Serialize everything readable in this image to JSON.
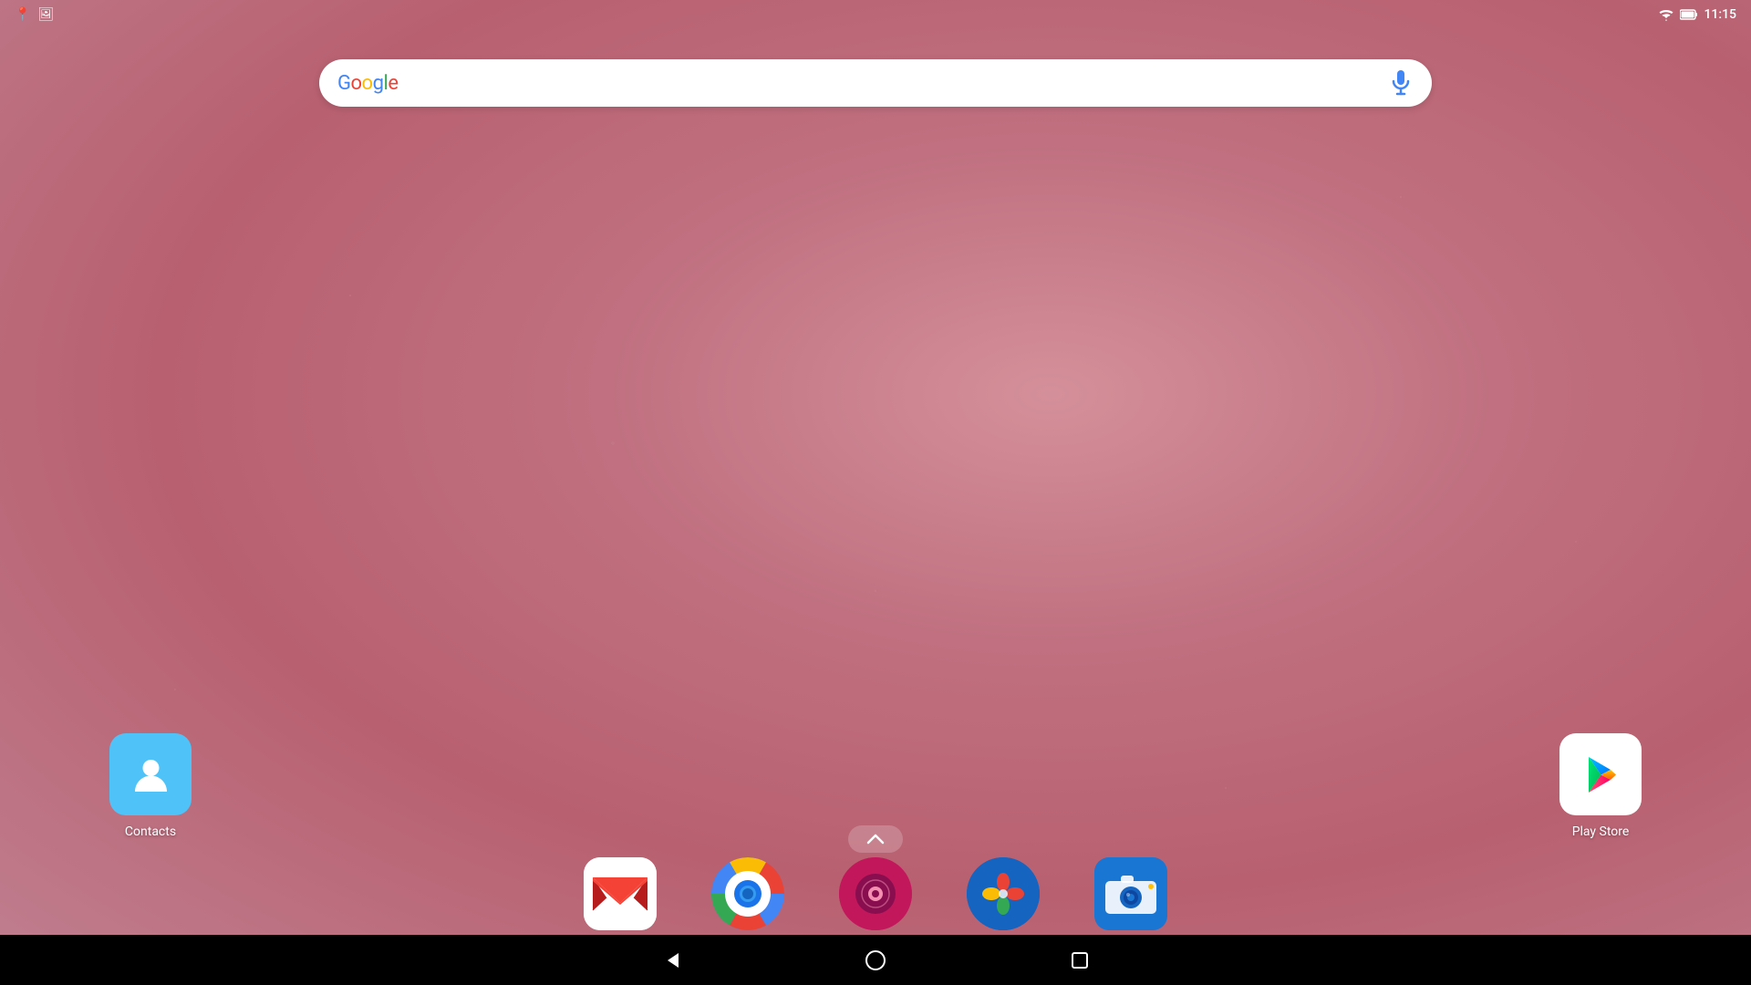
{
  "wallpaper": {
    "bg_color": "#c8808a"
  },
  "status_bar": {
    "time": "11:15",
    "wifi_icon": "wifi",
    "battery_icon": "battery",
    "location_icon": "location",
    "image_icon": "image"
  },
  "search_bar": {
    "logo_text": "Google",
    "placeholder": "",
    "mic_label": "voice search"
  },
  "desktop_apps": [
    {
      "id": "contacts",
      "label": "Contacts",
      "icon_type": "contacts"
    },
    {
      "id": "play-store",
      "label": "Play Store",
      "icon_type": "play-store"
    }
  ],
  "dock_apps": [
    {
      "id": "gmail",
      "label": "Gmail",
      "icon_type": "gmail"
    },
    {
      "id": "chrome",
      "label": "Chrome",
      "icon_type": "chrome"
    },
    {
      "id": "music",
      "label": "Music",
      "icon_type": "music"
    },
    {
      "id": "photos",
      "label": "Photos",
      "icon_type": "photos"
    },
    {
      "id": "camera",
      "label": "Camera",
      "icon_type": "camera"
    }
  ],
  "nav_bar": {
    "back_label": "back",
    "home_label": "home",
    "recents_label": "recents"
  },
  "app_drawer": {
    "chevron_label": "app drawer"
  }
}
